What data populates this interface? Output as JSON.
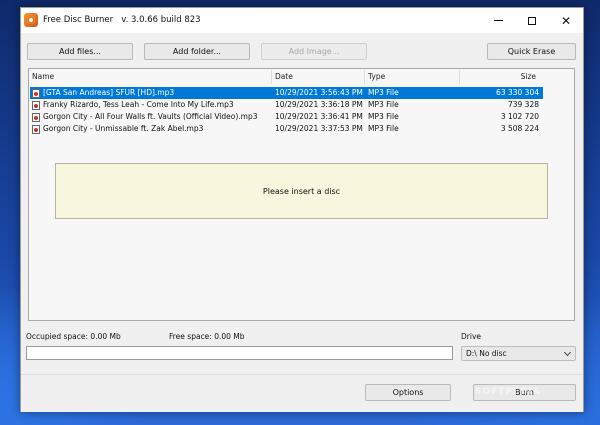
{
  "window": {
    "app_name": "Free Disc Burner",
    "version": "v. 3.0.66 build 823",
    "controls": {
      "minimize": "minimize",
      "maximize": "maximize",
      "close": "✕"
    }
  },
  "toolbar": {
    "add_files": "Add files...",
    "add_folder": "Add folder...",
    "add_image": "Add Image...",
    "quick_erase": "Quick Erase"
  },
  "file_list": {
    "columns": {
      "name": "Name",
      "date": "Date",
      "type": "Type",
      "size": "Size"
    },
    "rows": [
      {
        "name": "[GTA San Andreas] SFUR [HD].mp3",
        "date": "10/29/2021 3:56:43 PM",
        "type": "MP3 File",
        "size": "63 330 304"
      },
      {
        "name": "Franky Rizardo, Tess Leah - Come Into My Life.mp3",
        "date": "10/29/2021 3:36:18 PM",
        "type": "MP3 File",
        "size": "739 328"
      },
      {
        "name": "Gorgon City - All Four Walls ft. Vaults (Official Video).mp3",
        "date": "10/29/2021 3:36:41 PM",
        "type": "MP3 File",
        "size": "3 102 720"
      },
      {
        "name": "Gorgon City - Unmissable ft. Zak Abel.mp3",
        "date": "10/29/2021 3:37:53 PM",
        "type": "MP3 File",
        "size": "3 508 224"
      }
    ],
    "selected_index": 0,
    "notice": "Please insert a disc"
  },
  "status": {
    "occupied": "Occupied space: 0.00 Mb",
    "free": "Free space: 0.00 Mb",
    "progress": 0
  },
  "drive": {
    "label": "Drive",
    "selected": "D:\\ No disc"
  },
  "actions": {
    "options": "Options",
    "burn": "Burn"
  },
  "watermark": "SOFTPEDIA",
  "colors": {
    "selection": "#0078d7",
    "notice_bg": "#f8f6dc",
    "window_bg": "#f0f0f0"
  }
}
